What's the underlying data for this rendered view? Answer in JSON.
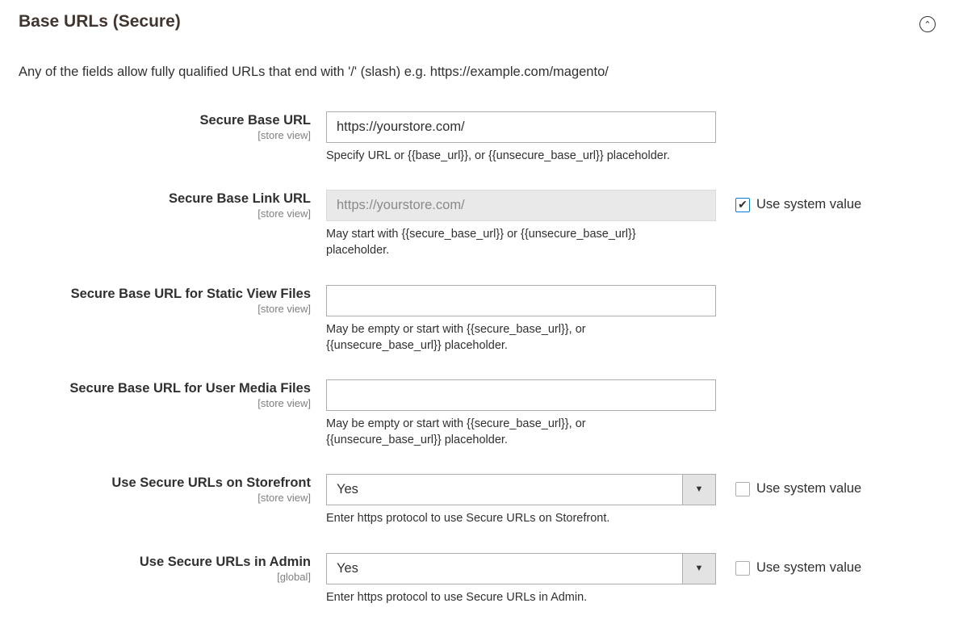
{
  "section": {
    "title": "Base URLs (Secure)",
    "intro": "Any of the fields allow fully qualified URLs that end with '/' (slash) e.g. https://example.com/magento/"
  },
  "fields": [
    {
      "label": "Secure Base URL",
      "scope": "[store view]",
      "value": "https://yourstore.com/",
      "note": "Specify URL or {{base_url}}, or {{unsecure_base_url}} placeholder."
    },
    {
      "label": "Secure Base Link URL",
      "scope": "[store view]",
      "value": "https://yourstore.com/",
      "note": "May start with {{secure_base_url}} or {{unsecure_base_url}} placeholder.",
      "system_label": "Use system value",
      "system_checked": true
    },
    {
      "label": "Secure Base URL for Static View Files",
      "scope": "[store view]",
      "value": "",
      "note": "May be empty or start with {{secure_base_url}}, or {{unsecure_base_url}} placeholder."
    },
    {
      "label": "Secure Base URL for User Media Files",
      "scope": "[store view]",
      "value": "",
      "note": "May be empty or start with {{secure_base_url}}, or {{unsecure_base_url}} placeholder."
    },
    {
      "label": "Use Secure URLs on Storefront",
      "scope": "[store view]",
      "value": "Yes",
      "note": "Enter https protocol to use Secure URLs on Storefront.",
      "system_label": "Use system value",
      "system_checked": false
    },
    {
      "label": "Use Secure URLs in Admin",
      "scope": "[global]",
      "value": "Yes",
      "note": "Enter https protocol to use Secure URLs in Admin.",
      "system_label": "Use system value",
      "system_checked": false
    }
  ]
}
